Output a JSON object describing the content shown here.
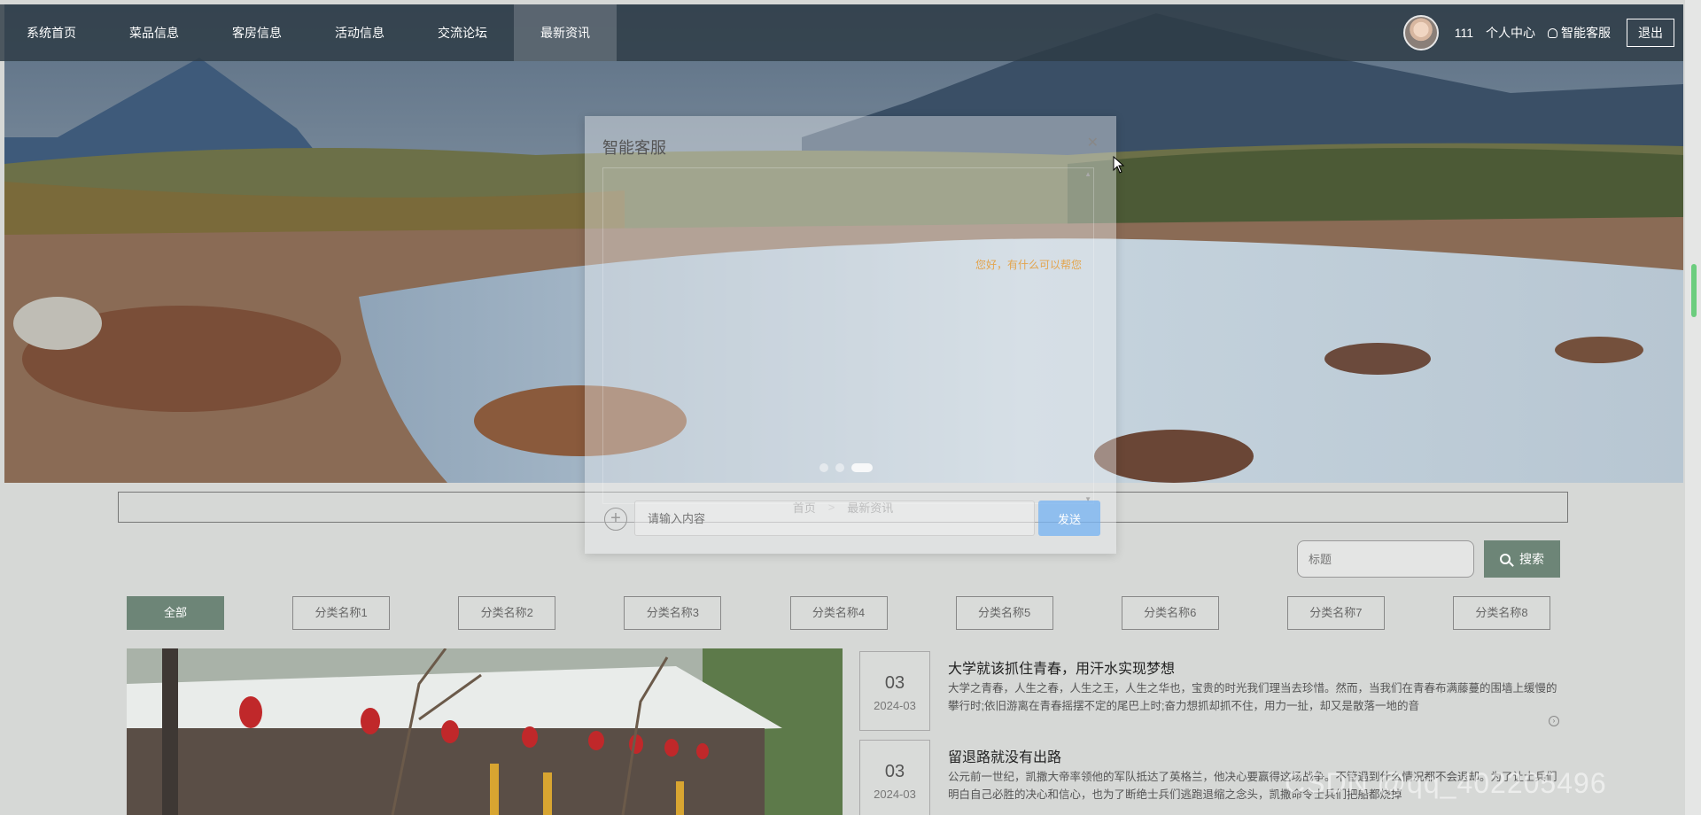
{
  "nav": {
    "items": [
      "系统首页",
      "菜品信息",
      "客房信息",
      "活动信息",
      "交流论坛",
      "最新资讯"
    ],
    "active_index": 5,
    "username": "111",
    "personal_center": "个人中心",
    "ai_service": "智能客服",
    "logout": "退出"
  },
  "carousel": {
    "slide_count": 3,
    "active_slide": 3
  },
  "breadcrumb": {
    "home": "首页",
    "separator": ">",
    "current": "最新资讯"
  },
  "search": {
    "placeholder": "标题",
    "button_label": "搜索"
  },
  "categories": [
    "全部",
    "分类名称1",
    "分类名称2",
    "分类名称3",
    "分类名称4",
    "分类名称5",
    "分类名称6",
    "分类名称7",
    "分类名称8"
  ],
  "news": [
    {
      "day": "03",
      "month": "2024-03",
      "title": "大学就该抓住青春，用汗水实现梦想",
      "desc": "大学之青春，人生之春，人生之王，人生之华也，宝贵的时光我们理当去珍惜。然而，当我们在青春布满藤蔓的围墙上缓慢的攀行时;依旧游离在青春摇摆不定的尾巴上时;奋力想抓却抓不住，用力一扯，却又是散落一地的音"
    },
    {
      "day": "03",
      "month": "2024-03",
      "title": "留退路就没有出路",
      "desc": "公元前一世纪，凯撒大帝率领他的军队抵达了英格兰，他决心要赢得这场战争。不管遇到什么情况都不会退却。为了让士兵们明白自己必胜的决心和信心，也为了断绝士兵们逃跑退缩之念头，凯撒命令士兵们把船都烧掉"
    }
  ],
  "chat": {
    "title": "智能客服",
    "input_placeholder": "请输入内容",
    "send_label": "发送",
    "message": "您好，有什么可以帮您"
  },
  "watermark": "CSDN @qq_402205496",
  "colors": {
    "accent": "#6d8577",
    "send_button": "#64aaf5",
    "nav_bg": "#2d3a44"
  }
}
